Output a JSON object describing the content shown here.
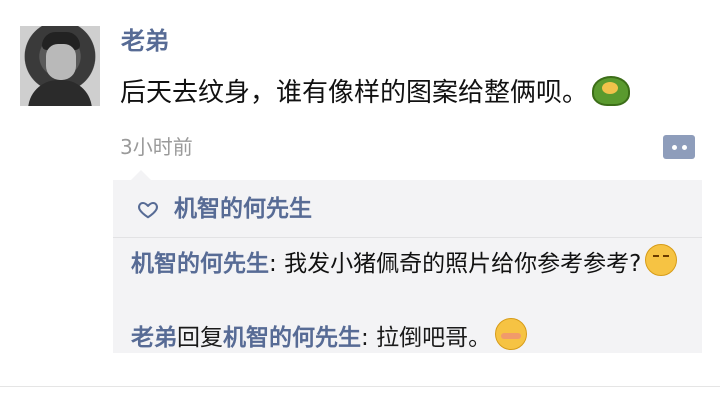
{
  "post": {
    "username": "老弟",
    "text": "后天去纹身，谁有像样的图案给整俩呗。",
    "emoji": "turtle-emoji",
    "timestamp": "3小时前"
  },
  "likes": {
    "names": "机智的何先生"
  },
  "comments": [
    {
      "author": "机智的何先生",
      "separator": ": ",
      "text": "我发小猪佩奇的照片给你参考参考?",
      "emoji": "smile-emoji"
    },
    {
      "author": "老弟",
      "reply_word": "回复",
      "reply_to": "机智的何先生",
      "separator": ": ",
      "text": "拉倒吧哥。",
      "emoji": "shy-emoji"
    }
  ],
  "colors": {
    "name_blue": "#576b95",
    "panel_bg": "#f3f3f5",
    "timestamp_gray": "#9a9a9a",
    "comment_button": "#8e9dbb"
  }
}
